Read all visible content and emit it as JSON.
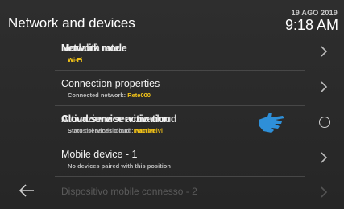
{
  "header": {
    "title": "Network and devices",
    "date": "19 AGO 2019",
    "time": "9:18 AM"
  },
  "items": [
    {
      "label_a": "Network mode",
      "label_b": "Modalità rete",
      "sub_a": "Wi-Fi",
      "sub_b": "Wi-Fi"
    },
    {
      "label": "Connection properties",
      "sub_prefix": "Connected network:",
      "sub_value": "Rete000"
    },
    {
      "label_a": "Cloud service activation",
      "label_b": "Attivazione servizio cloud",
      "sub_prefix_a": "Status services cloud:",
      "sub_value_a": "Inactive",
      "sub_prefix_b": "Stato dei servizi cloud:",
      "sub_value_b": "Non attivi"
    },
    {
      "label": "Mobile device - 1",
      "sub": "No devices paired with this position"
    }
  ],
  "ghost_item": {
    "label": "Dispositivo mobile connesso - 2"
  },
  "icons": {
    "chevron": "chevron-right-icon",
    "radio": "radio-empty-icon",
    "hand": "hand-pointer-icon",
    "back": "back-arrow-icon"
  },
  "colors": {
    "accent": "#f5c518",
    "hand": "#2e8fd8",
    "background": "#2a2a2a"
  }
}
